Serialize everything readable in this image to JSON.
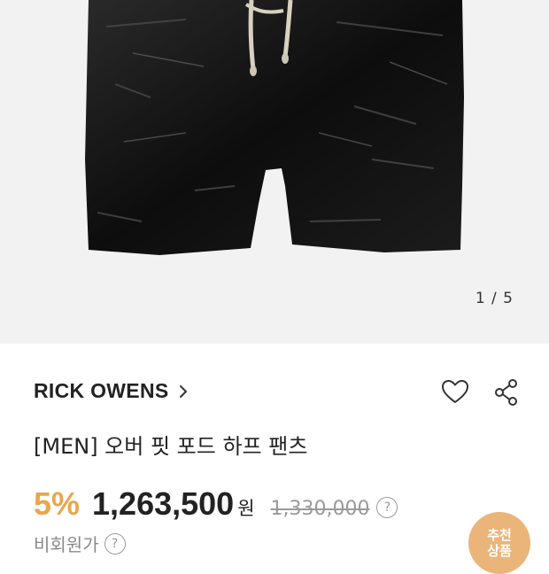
{
  "gallery": {
    "counter": "1 / 5"
  },
  "product": {
    "brand": "RICK OWENS",
    "title": "[MEN] 오버 핏 포드 하프 팬츠",
    "discount": "5%",
    "price": "1,263,500",
    "currency": "원",
    "original_price": "1,330,000",
    "info_mark": "?",
    "member_price_label": "비회원가"
  },
  "fab": {
    "line1": "추천",
    "line2": "상품"
  },
  "colors": {
    "accent": "#e8a74b",
    "fab": "#ebb57a",
    "gallery_bg": "#f2f2f2"
  }
}
